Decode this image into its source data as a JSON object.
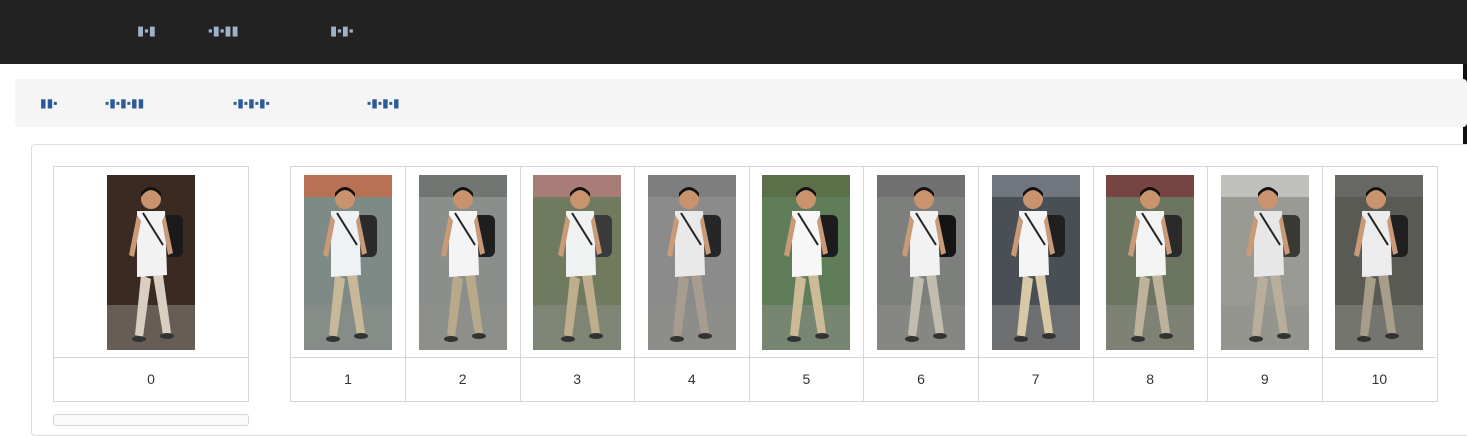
{
  "nav": {
    "items": [
      "▮▪▮",
      "▪▮▪▮▮",
      "▮▪▮▪"
    ]
  },
  "breadcrumb": {
    "items": [
      "▮▮▪",
      "▪▮▪▮▪▮▮",
      "▪▮▪▮▪▮▪",
      "▪▮▪▮▪▮"
    ]
  },
  "query": {
    "label": "0",
    "bg": "#3a2a22",
    "shirt": "#f2f2f2",
    "pants": "#d8cfc0",
    "bag": "#1a1a1a"
  },
  "gallery": [
    {
      "label": "1",
      "bg": "#7d8a86",
      "shirt": "#eef2f4",
      "pants": "#c9b79a",
      "bag": "#2b2b2b",
      "top": "#c86a4a"
    },
    {
      "label": "2",
      "bg": "#8a8f8c",
      "shirt": "#f4f4f4",
      "pants": "#b7a98a",
      "bag": "#1f1f1f",
      "top": "#6b6f6c"
    },
    {
      "label": "3",
      "bg": "#6f7a5e",
      "shirt": "#f0f2f2",
      "pants": "#bfae8e",
      "bag": "#3a3a3a",
      "top": "#b77d7d"
    },
    {
      "label": "4",
      "bg": "#8b8b8b",
      "shirt": "#e9e9e9",
      "pants": "#a89c90",
      "bag": "#262626",
      "top": "#7a7a7a"
    },
    {
      "label": "5",
      "bg": "#5f7d58",
      "shirt": "#f7f7f7",
      "pants": "#cdbb98",
      "bag": "#1c1c1c",
      "top": "#5a6b46"
    },
    {
      "label": "6",
      "bg": "#7c7f7c",
      "shirt": "#f2f2f2",
      "pants": "#c2bcae",
      "bag": "#141414",
      "top": "#6e6e6e"
    },
    {
      "label": "7",
      "bg": "#4a4f56",
      "shirt": "#f5f5f5",
      "pants": "#d7c9a6",
      "bag": "#202020",
      "top": "#7a8088"
    },
    {
      "label": "8",
      "bg": "#6b7560",
      "shirt": "#f3f3f3",
      "pants": "#bdb39c",
      "bag": "#2a2a2a",
      "top": "#7a3a3a"
    },
    {
      "label": "9",
      "bg": "#9a9a95",
      "shirt": "#e7e7e7",
      "pants": "#b9ad9b",
      "bag": "#3a3a34",
      "top": "#c8c8c4"
    },
    {
      "label": "10",
      "bg": "#5a5a55",
      "shirt": "#ececec",
      "pants": "#a89d89",
      "bag": "#202020",
      "top": "#6a6a66"
    }
  ]
}
